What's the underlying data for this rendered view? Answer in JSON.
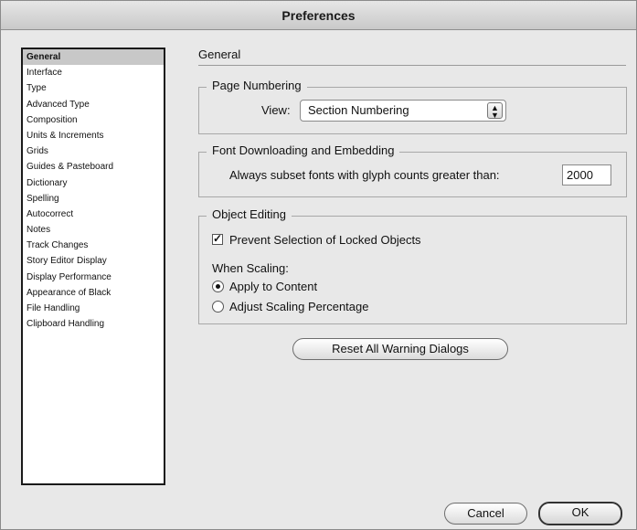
{
  "window": {
    "title": "Preferences"
  },
  "sidebar": {
    "items": [
      {
        "label": "General",
        "selected": true
      },
      {
        "label": "Interface"
      },
      {
        "label": "Type"
      },
      {
        "label": "Advanced Type"
      },
      {
        "label": "Composition"
      },
      {
        "label": "Units & Increments"
      },
      {
        "label": "Grids"
      },
      {
        "label": "Guides & Pasteboard"
      },
      {
        "label": "Dictionary"
      },
      {
        "label": "Spelling"
      },
      {
        "label": "Autocorrect"
      },
      {
        "label": "Notes"
      },
      {
        "label": "Track Changes"
      },
      {
        "label": "Story Editor Display"
      },
      {
        "label": "Display Performance"
      },
      {
        "label": "Appearance of Black"
      },
      {
        "label": "File Handling"
      },
      {
        "label": "Clipboard Handling"
      }
    ]
  },
  "content": {
    "title": "General",
    "page_numbering": {
      "legend": "Page Numbering",
      "view_label": "View:",
      "view_value": "Section Numbering"
    },
    "font_downloading": {
      "legend": "Font Downloading and Embedding",
      "subset_label": "Always subset fonts with glyph counts greater than:",
      "subset_value": "2000"
    },
    "object_editing": {
      "legend": "Object Editing",
      "prevent_selection_label": "Prevent Selection of Locked Objects",
      "prevent_selection_checked": true,
      "when_scaling_label": "When Scaling:",
      "apply_to_content_label": "Apply to Content",
      "adjust_scaling_label": "Adjust Scaling Percentage",
      "selected_scaling_option": "Apply to Content"
    },
    "reset_button_label": "Reset All Warning Dialogs"
  },
  "footer": {
    "cancel_label": "Cancel",
    "ok_label": "OK"
  }
}
